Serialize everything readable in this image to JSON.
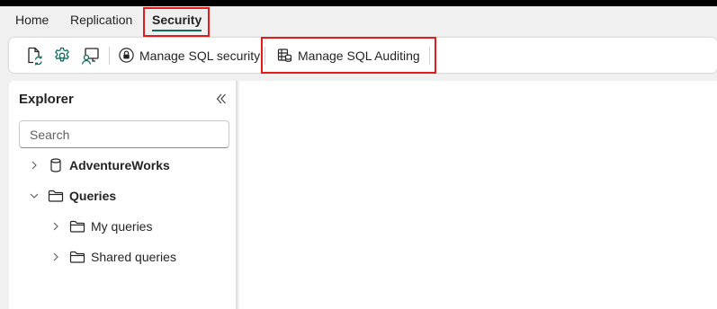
{
  "tabs": [
    {
      "label": "Home"
    },
    {
      "label": "Replication"
    },
    {
      "label": "Security"
    }
  ],
  "toolbar": {
    "icons": [
      "refresh-file-icon",
      "settings-gear-icon",
      "person-monitor-icon"
    ],
    "manage_security_label": "Manage SQL security",
    "manage_auditing_label": "Manage SQL Auditing"
  },
  "explorer": {
    "title": "Explorer",
    "search_placeholder": "Search",
    "tree": [
      {
        "label": "AdventureWorks",
        "icon": "database-icon",
        "expanded": false
      },
      {
        "label": "Queries",
        "icon": "folder-icon",
        "expanded": true
      },
      {
        "label": "My queries",
        "icon": "folder-icon",
        "expanded": false
      },
      {
        "label": "Shared queries",
        "icon": "folder-icon",
        "expanded": false
      }
    ]
  },
  "colors": {
    "accent": "#0f6b60",
    "highlight": "#e31b1b",
    "panel": "#ffffff",
    "background": "#f0f0f0"
  }
}
